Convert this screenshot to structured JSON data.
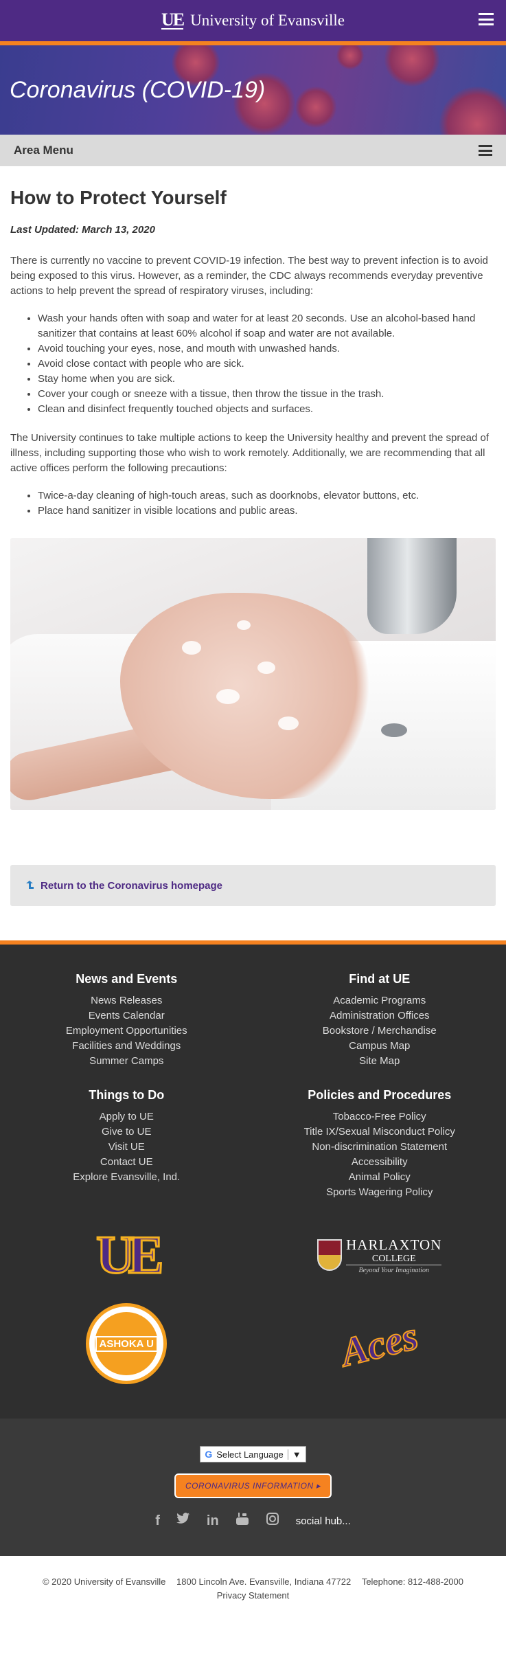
{
  "header": {
    "logo_text": "UE",
    "university_name": "University of Evansville",
    "menu_icon": "hamburger-icon"
  },
  "hero": {
    "title": "Coronavirus (COVID-19)"
  },
  "area_menu": {
    "label": "Area Menu",
    "menu_icon": "hamburger-icon"
  },
  "article": {
    "heading": "How to Protect Yourself",
    "updated": "Last Updated: March 13, 2020",
    "intro": "There is currently no vaccine to prevent COVID-19 infection. The best way to prevent infection is to avoid being exposed to this virus. However, as a reminder, the CDC always recommends everyday preventive actions to help prevent the spread of respiratory viruses, including:",
    "cdc_actions": [
      "Wash your hands often with soap and water for at least 20 seconds. Use an alcohol-based hand sanitizer that contains at least 60% alcohol if soap and water are not available.",
      "Avoid touching your eyes, nose, and mouth with unwashed hands.",
      "Avoid close contact with people who are sick.",
      "Stay home when you are sick.",
      "Cover your cough or sneeze with a tissue, then throw the tissue in the trash.",
      "Clean and disinfect frequently touched objects and surfaces."
    ],
    "university_paragraph": "The University continues to take multiple actions to keep the University healthy and prevent the spread of illness, including supporting those who wish to work remotely. Additionally, we are recommending that all active offices perform the following precautions:",
    "office_precautions": [
      "Twice-a-day cleaning of high-touch areas, such as doorknobs, elevator buttons, etc.",
      "Place hand sanitizer in visible locations and public areas."
    ],
    "return_link": "Return to the Coronavirus homepage"
  },
  "footer": {
    "sections": [
      {
        "title": "News and Events",
        "links": [
          "News Releases",
          "Events Calendar",
          "Employment Opportunities",
          "Facilities and Weddings",
          "Summer Camps"
        ]
      },
      {
        "title": "Find at UE",
        "links": [
          "Academic Programs",
          "Administration Offices",
          "Bookstore / Merchandise",
          "Campus Map",
          "Site Map"
        ]
      },
      {
        "title": "Things to Do",
        "links": [
          "Apply to UE",
          "Give to UE",
          "Visit UE",
          "Contact UE",
          "Explore Evansville, Ind."
        ]
      },
      {
        "title": "Policies and Procedures",
        "links": [
          "Tobacco-Free Policy",
          "Title IX/Sexual Misconduct Policy",
          "Non-discrimination Statement",
          "Accessibility",
          "Animal Policy",
          "Sports Wagering Policy"
        ]
      }
    ],
    "logos": {
      "ue": "UE",
      "harlaxton_name": "HARLAXTON",
      "harlaxton_college": "COLLEGE",
      "harlaxton_tagline": "Beyond Your Imagination",
      "ashoka": "ASHOKA U",
      "aces": "Aces"
    },
    "language_label": "Select Language",
    "language_arrow": "▼",
    "covid_button": "CORONAVIRUS INFORMATION ▸",
    "social_icons": [
      "facebook-icon",
      "twitter-icon",
      "linkedin-icon",
      "youtube-icon",
      "instagram-icon"
    ],
    "social_hub": "social hub...",
    "copyright": "© 2020 University of Evansville",
    "address": "1800 Lincoln Ave. Evansville, Indiana 47722",
    "telephone": "Telephone: 812-488-2000",
    "privacy": "Privacy Statement"
  },
  "colors": {
    "purple": "#4e2a84",
    "orange": "#f58220",
    "footer_dark": "#2f2f2f"
  }
}
